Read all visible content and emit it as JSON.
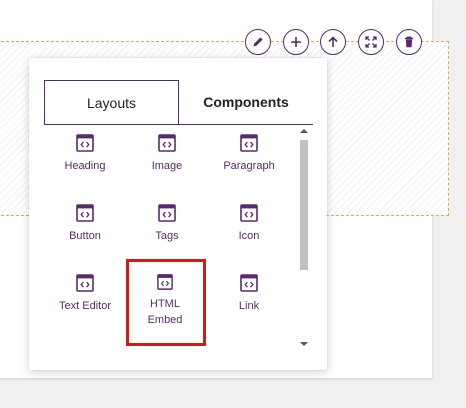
{
  "colors": {
    "accent": "#5a2a6e",
    "highlight": "#d11a1a",
    "guide": "#e0b040"
  },
  "toolbar": {
    "buttons": [
      {
        "icon": "pencil-icon"
      },
      {
        "icon": "plus-icon"
      },
      {
        "icon": "arrow-up-icon"
      },
      {
        "icon": "expand-icon"
      },
      {
        "icon": "trash-icon"
      }
    ]
  },
  "popup": {
    "tabs": [
      {
        "label": "Layouts",
        "active": false
      },
      {
        "label": "Components",
        "active": true
      }
    ],
    "items": [
      {
        "label": "Heading",
        "icon": "code-window-icon"
      },
      {
        "label": "Image",
        "icon": "code-window-icon"
      },
      {
        "label": "Paragraph",
        "icon": "code-window-icon"
      },
      {
        "label": "Button",
        "icon": "code-window-icon"
      },
      {
        "label": "Tags",
        "icon": "code-window-icon"
      },
      {
        "label": "Icon",
        "icon": "code-window-icon"
      },
      {
        "label": "Text Editor",
        "icon": "code-window-icon"
      },
      {
        "label": "HTML Embed",
        "icon": "code-window-icon",
        "highlighted": true
      },
      {
        "label": "Link",
        "icon": "code-window-icon"
      }
    ]
  }
}
